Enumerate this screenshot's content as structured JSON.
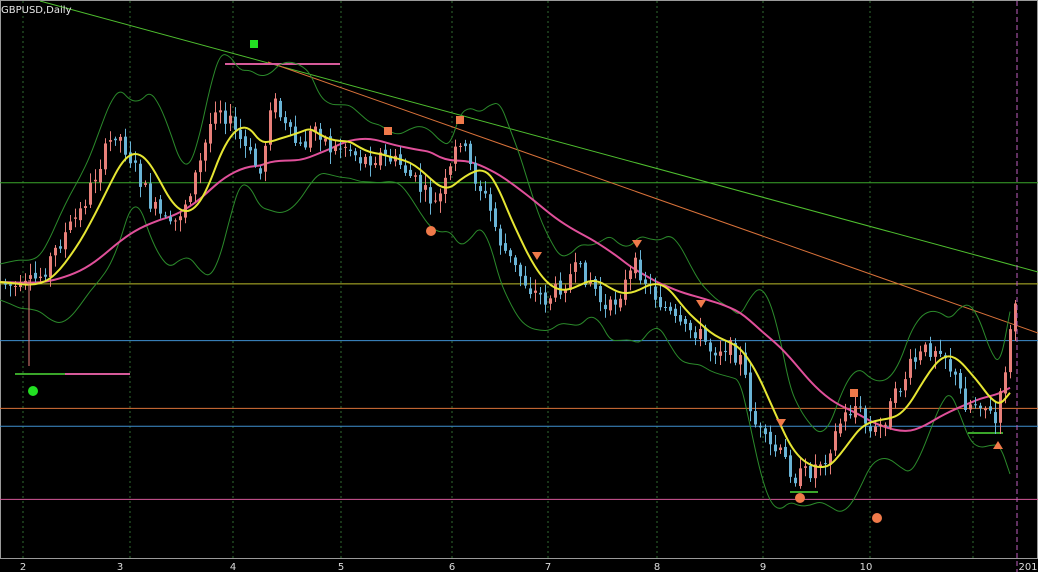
{
  "symbol": "GBPUSD,Daily",
  "colors": {
    "background": "#000000",
    "bull": "#e8807a",
    "bear": "#6ab4d6",
    "ma_fast": "#e6e633",
    "ma_slow": "#e0509a",
    "bands": "#2b8a2b",
    "grid": "#2f6b2f",
    "trend_green": "#4fbf2f",
    "trend_orange": "#d9723a",
    "level_green": "#3aa52a",
    "level_yellow": "#bdbd2a",
    "level_blue": "#3f8fcf",
    "level_orange": "#d9723a",
    "level_pink": "#d65a9a",
    "marker_orange": "#f07a4a",
    "marker_green": "#22e022",
    "cursor": "#c060c0"
  },
  "chart_data": {
    "type": "candlestick",
    "x_ticks": [
      "2",
      "3",
      "4",
      "5",
      "6",
      "7",
      "8",
      "9",
      "10",
      "201"
    ],
    "grid": true,
    "levels": [
      {
        "color": "level_green",
        "value": 1.3215
      },
      {
        "color": "level_yellow",
        "value": 1.3085
      },
      {
        "color": "level_blue",
        "value": 1.3012
      },
      {
        "color": "level_blue",
        "value": 1.2902
      },
      {
        "color": "level_orange",
        "value": 1.2925
      },
      {
        "color": "level_pink",
        "value": 1.2808
      }
    ]
  }
}
